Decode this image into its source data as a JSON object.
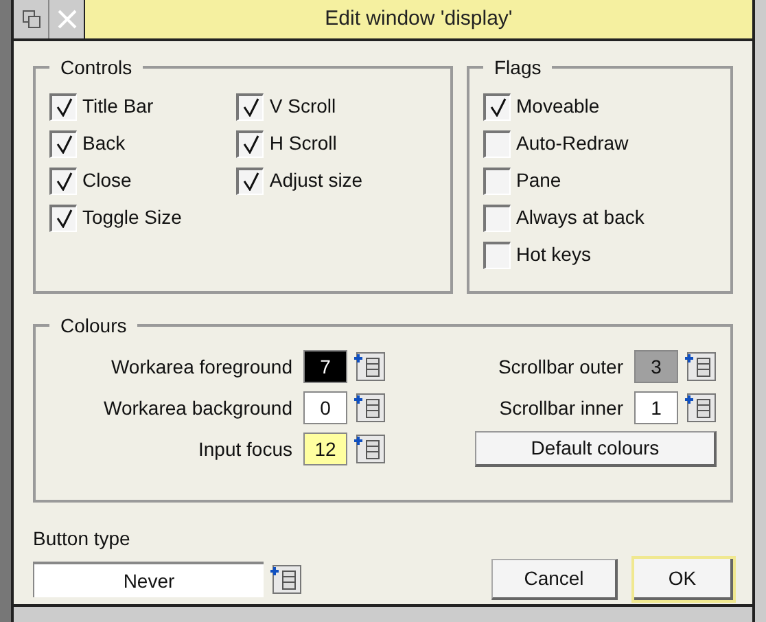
{
  "window": {
    "title": "Edit window 'display'"
  },
  "controls": {
    "title": "Controls",
    "items": [
      {
        "label": "Title Bar",
        "checked": true
      },
      {
        "label": "Back",
        "checked": true
      },
      {
        "label": "Close",
        "checked": true
      },
      {
        "label": "Toggle Size",
        "checked": true
      },
      {
        "label": "V Scroll",
        "checked": true
      },
      {
        "label": "H Scroll",
        "checked": true
      },
      {
        "label": "Adjust size",
        "checked": true
      }
    ]
  },
  "flags": {
    "title": "Flags",
    "items": [
      {
        "label": "Moveable",
        "checked": true
      },
      {
        "label": "Auto-Redraw",
        "checked": false
      },
      {
        "label": "Pane",
        "checked": false
      },
      {
        "label": "Always at back",
        "checked": false
      },
      {
        "label": "Hot keys",
        "checked": false
      }
    ]
  },
  "colours": {
    "title": "Colours",
    "left": [
      {
        "label": "Workarea foreground",
        "value": "7",
        "color": "#000000"
      },
      {
        "label": "Workarea background",
        "value": "0",
        "color": "#ffffff"
      },
      {
        "label": "Input focus",
        "value": "12",
        "color": "#ffffa0"
      }
    ],
    "right": [
      {
        "label": "Scrollbar outer",
        "value": "3",
        "color": "#a0a0a0"
      },
      {
        "label": "Scrollbar inner",
        "value": "1",
        "color": "#ffffff"
      }
    ],
    "default_button": "Default colours"
  },
  "button_type": {
    "label": "Button type",
    "value": "Never"
  },
  "buttons": [
    {
      "label": "Cancel",
      "default": false
    },
    {
      "label": "OK",
      "default": true
    }
  ]
}
